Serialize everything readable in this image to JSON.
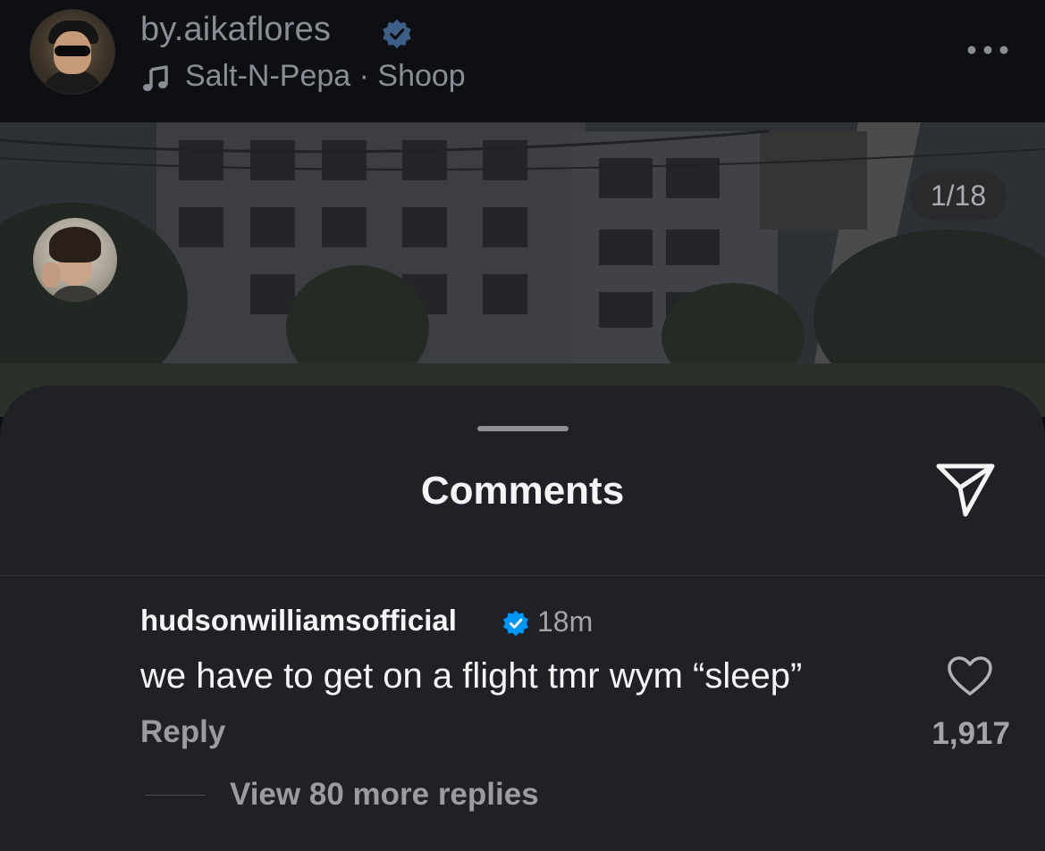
{
  "post": {
    "username": "by.aikaflores",
    "verified": true,
    "track": "Salt-N-Pepa · Shoop",
    "image_counter": "1/18"
  },
  "icons": {
    "verified": "verified-badge-icon",
    "music": "music-note-icon",
    "more": "more-options-icon",
    "send": "send-icon",
    "like": "heart-icon"
  },
  "comments_sheet": {
    "title": "Comments",
    "comments": [
      {
        "username": "hudsonwilliamsofficial",
        "verified": true,
        "time": "18m",
        "text": "we have to get on a flight tmr wym “sleep”",
        "reply_label": "Reply",
        "like_count": "1,917",
        "view_replies_label": "View 80 more replies"
      }
    ]
  },
  "colors": {
    "verified_blue": "#0095f6",
    "sheet_bg": "#202127",
    "text_primary": "#f5f5f5",
    "text_secondary": "#9a9ca2"
  }
}
